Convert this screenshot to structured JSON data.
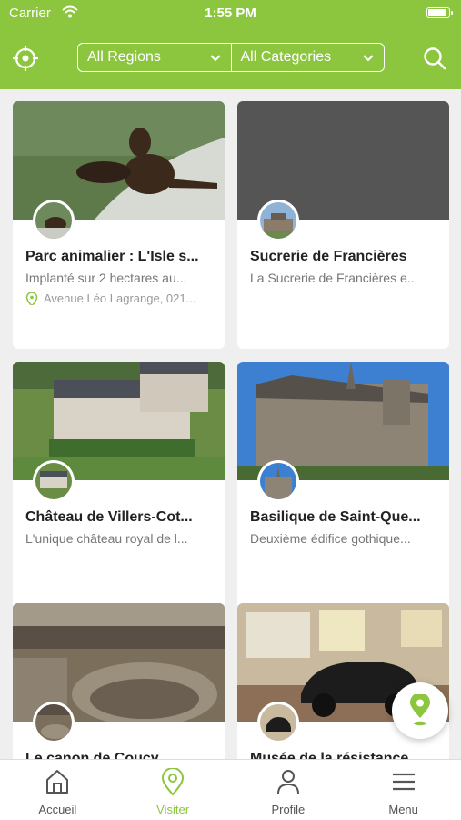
{
  "status_bar": {
    "carrier": "Carrier",
    "time": "1:55 PM"
  },
  "header": {
    "locate_icon": "crosshair-icon",
    "search_icon": "search-icon",
    "region_filter": "All Regions",
    "category_filter": "All Categories"
  },
  "places": [
    {
      "title": "Parc animalier : L'Isle s...",
      "description": "Implanté sur 2 hectares au...",
      "address": "Avenue Léo Lagrange, 021..."
    },
    {
      "title": "Sucrerie de Francières",
      "description": "La Sucrerie de Francières e...",
      "address": ""
    },
    {
      "title": "Château de Villers-Cot...",
      "description": "L'unique château royal de l...",
      "address": ""
    },
    {
      "title": "Basilique de Saint-Que...",
      "description": "Deuxième édifice gothique...",
      "address": ""
    },
    {
      "title": "Le canon de Coucy",
      "description": "",
      "address": ""
    },
    {
      "title": "Musée de la résistance",
      "description": "",
      "address": ""
    }
  ],
  "tabs": [
    {
      "label": "Accueil",
      "icon": "home-icon"
    },
    {
      "label": "Visiter",
      "icon": "map-pin-icon",
      "active": true
    },
    {
      "label": "Profile",
      "icon": "user-icon"
    },
    {
      "label": "Menu",
      "icon": "menu-icon"
    }
  ],
  "fab_icon": "map-pin-icon",
  "colors": {
    "accent": "#8cc63f",
    "background": "#efefef",
    "title": "#222222",
    "description": "#777777"
  }
}
